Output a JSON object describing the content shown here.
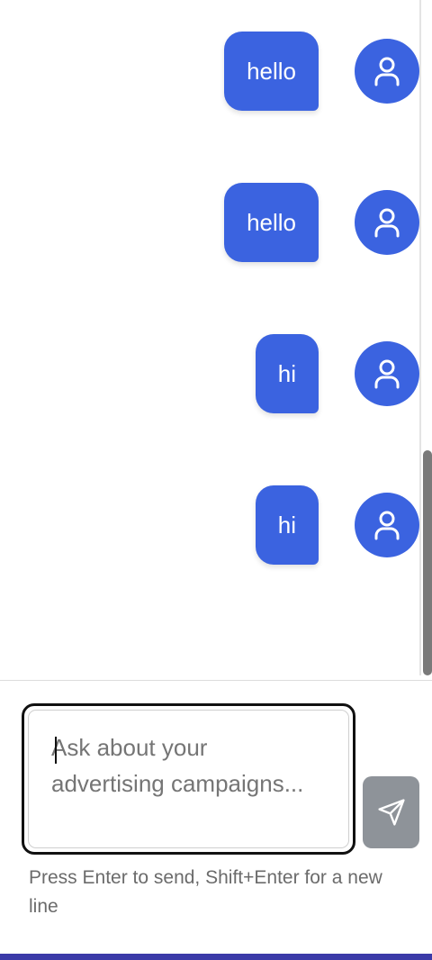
{
  "messages": [
    {
      "text": "hello",
      "sender": "user"
    },
    {
      "text": "hello",
      "sender": "user"
    },
    {
      "text": "hi",
      "sender": "user"
    },
    {
      "text": "hi",
      "sender": "user"
    }
  ],
  "composer": {
    "placeholder": "Ask about your advertising campaigns...",
    "value": "",
    "send_icon": "send-icon",
    "hint": "Press Enter to send, Shift+Enter for a new line"
  },
  "icons": {
    "avatar": "user-icon"
  },
  "colors": {
    "accent": "#3b63e0",
    "send_button_disabled": "#8e9399",
    "hint_text": "#6b6b6b"
  }
}
